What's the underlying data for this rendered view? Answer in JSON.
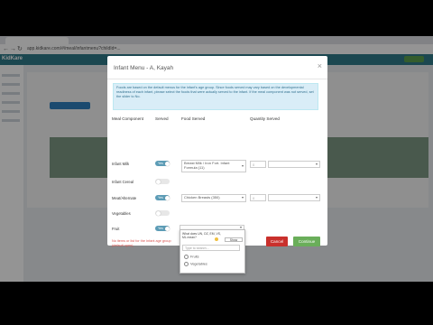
{
  "browser": {
    "url": "app.kidkare.com/#/meal/infantmenu?childId=..."
  },
  "app": {
    "logo_text": "KidKare"
  },
  "modal": {
    "title": "Infant Menu - A, Kayah",
    "close_glyph": "×",
    "info_text": "Foods are based on the default menus for the infant's age group. Since foods served may vary based on the developmental readiness of each infant, please select the foods that were actually served to the infant. If the meal component was not served, set the slider to No.",
    "headers": {
      "component": "Meal Component",
      "served": "Served",
      "food": "Food Served",
      "quantity": "Quantity Served"
    },
    "rows": [
      {
        "label": "Infant Milk",
        "toggle": "Yes",
        "food": "Breast Milk / Iron Fort. Infant Formula (11)",
        "qty": "0"
      },
      {
        "label": "Infant Cereal",
        "toggle": "",
        "food": "",
        "qty": ""
      },
      {
        "label": "Meat/Alternate",
        "toggle": "Yes",
        "food": "Chicken Breasts (350)",
        "qty": "0"
      },
      {
        "label": "Vegetables",
        "toggle": "",
        "food": "",
        "qty": ""
      },
      {
        "label": "Fruit",
        "toggle": "Yes",
        "food": "",
        "qty": ""
      }
    ],
    "warning": "No items or list for the Infant age group (default open).",
    "cancel_label": "Cancel",
    "continue_label": "Continue"
  },
  "dropdown": {
    "question": "What does UN, OZ, EM, VS, ML mean?",
    "button_label": "Show",
    "search_placeholder": "Type to search...",
    "options": [
      "Fruits",
      "Vegetables"
    ]
  },
  "colors": {
    "app_header": "#2f7a8a",
    "toggle_on": "#5c9cb6",
    "cancel": "#c9302c",
    "continue": "#6aae5a",
    "info_bg": "#d9edf7"
  }
}
